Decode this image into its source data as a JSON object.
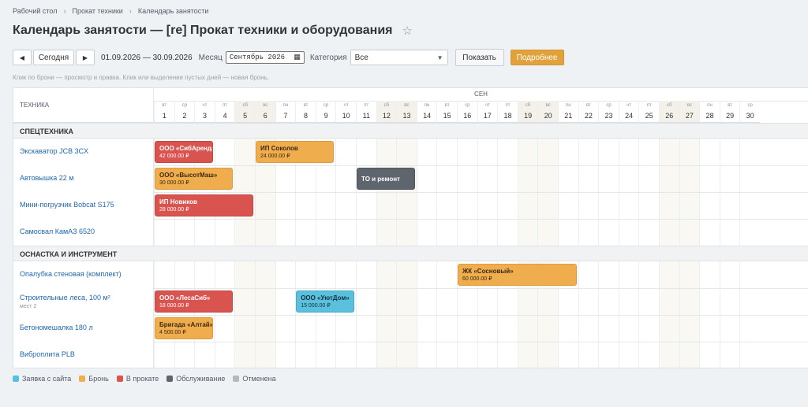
{
  "breadcrumb": [
    "Рабочий стол",
    "Прокат техники",
    "Календарь занятости"
  ],
  "page": {
    "title": "Календарь занятости — [re] Прокат техники и оборудования"
  },
  "toolbar": {
    "today_label": "Сегодня",
    "date_range": "01.09.2026 — 30.09.2026",
    "month_label": "Месяц",
    "month_value": "Сентябрь 2026",
    "category_label": "Категория",
    "category_value": "Все",
    "show_label": "Показать",
    "more_label": "Подробнее"
  },
  "hint": "Клик по брони — просмотр и правка. Клик или выделение пустых дней — новая бронь.",
  "grid": {
    "header_left": "ТЕХНИКА",
    "month": "СЕН",
    "days": [
      {
        "num": "1",
        "dow": "вт",
        "weekend": false
      },
      {
        "num": "2",
        "dow": "ср",
        "weekend": false
      },
      {
        "num": "3",
        "dow": "чт",
        "weekend": false
      },
      {
        "num": "4",
        "dow": "пт",
        "weekend": false
      },
      {
        "num": "5",
        "dow": "сб",
        "weekend": true
      },
      {
        "num": "6",
        "dow": "вс",
        "weekend": true
      },
      {
        "num": "7",
        "dow": "пн",
        "weekend": false
      },
      {
        "num": "8",
        "dow": "вт",
        "weekend": false
      },
      {
        "num": "9",
        "dow": "ср",
        "weekend": false
      },
      {
        "num": "10",
        "dow": "чт",
        "weekend": false
      },
      {
        "num": "11",
        "dow": "пт",
        "weekend": false
      },
      {
        "num": "12",
        "dow": "сб",
        "weekend": true
      },
      {
        "num": "13",
        "dow": "вс",
        "weekend": true
      },
      {
        "num": "14",
        "dow": "пн",
        "weekend": false
      },
      {
        "num": "15",
        "dow": "вт",
        "weekend": false
      },
      {
        "num": "16",
        "dow": "ср",
        "weekend": false
      },
      {
        "num": "17",
        "dow": "чт",
        "weekend": false
      },
      {
        "num": "18",
        "dow": "пт",
        "weekend": false
      },
      {
        "num": "19",
        "dow": "сб",
        "weekend": true
      },
      {
        "num": "20",
        "dow": "вс",
        "weekend": true
      },
      {
        "num": "21",
        "dow": "пн",
        "weekend": false
      },
      {
        "num": "22",
        "dow": "вт",
        "weekend": false
      },
      {
        "num": "23",
        "dow": "ср",
        "weekend": false
      },
      {
        "num": "24",
        "dow": "чт",
        "weekend": false
      },
      {
        "num": "25",
        "dow": "пт",
        "weekend": false
      },
      {
        "num": "26",
        "dow": "сб",
        "weekend": true
      },
      {
        "num": "27",
        "dow": "вс",
        "weekend": true
      },
      {
        "num": "28",
        "dow": "пн",
        "weekend": false
      },
      {
        "num": "29",
        "dow": "вт",
        "weekend": false
      },
      {
        "num": "30",
        "dow": "ср",
        "weekend": false
      }
    ],
    "groups": [
      {
        "name": "СПЕЦТЕХНИКА",
        "resources": [
          {
            "name": "Экскаватор JCB 3CX",
            "sub": "",
            "bookings": [
              {
                "title": "ООО «СибАренда»",
                "amount": "42 000.00 ₽",
                "status": "rented",
                "start": 1,
                "end": 3
              },
              {
                "title": "ИП Соколов",
                "amount": "24 000.00 ₽",
                "status": "booked",
                "start": 6,
                "end": 9
              }
            ]
          },
          {
            "name": "Автовышка 22 м",
            "sub": "",
            "bookings": [
              {
                "title": "ООО «ВысотМаш»",
                "amount": "30 000.00 ₽",
                "status": "booked",
                "start": 1,
                "end": 4
              },
              {
                "title": "ТО и ремонт",
                "amount": "",
                "status": "service",
                "start": 11,
                "end": 13
              }
            ]
          },
          {
            "name": "Мини-погрузчик Bobcat S175",
            "sub": "",
            "bookings": [
              {
                "title": "ИП Новиков",
                "amount": "28 000.00 ₽",
                "status": "rented",
                "start": 1,
                "end": 5
              }
            ]
          },
          {
            "name": "Самосвал КамАЗ 6520",
            "sub": "",
            "bookings": []
          }
        ]
      },
      {
        "name": "ОСНАСТКА И ИНСТРУМЕНТ",
        "resources": [
          {
            "name": "Опалубка стеновая (комплект)",
            "sub": "",
            "bookings": [
              {
                "title": "ЖК «Сосновый»",
                "amount": "60 000.00 ₽",
                "status": "booked",
                "start": 16,
                "end": 21
              }
            ]
          },
          {
            "name": "Строительные леса, 100 м²",
            "sub": "мест 2",
            "bookings": [
              {
                "title": "ООО «ЛесаСиб»",
                "amount": "18 000.00 ₽",
                "status": "rented",
                "start": 1,
                "end": 4
              },
              {
                "title": "ООО «УютДом»",
                "amount": "15 000.00 ₽",
                "status": "request",
                "start": 8,
                "end": 10
              }
            ]
          },
          {
            "name": "Бетономешалка 180 л",
            "sub": "",
            "bookings": [
              {
                "title": "Бригада «Алтай»",
                "amount": "4 500.00 ₽",
                "status": "booked",
                "start": 1,
                "end": 3
              }
            ]
          },
          {
            "name": "Виброплита PLB",
            "sub": "",
            "bookings": []
          }
        ]
      }
    ]
  },
  "legend": [
    {
      "label": "Заявка с сайта",
      "color": "#5bc0de"
    },
    {
      "label": "Бронь",
      "color": "#f0ad4e"
    },
    {
      "label": "В прокате",
      "color": "#d9534f"
    },
    {
      "label": "Обслуживание",
      "color": "#5e656c"
    },
    {
      "label": "Отменена",
      "color": "#b5b9bd"
    }
  ]
}
